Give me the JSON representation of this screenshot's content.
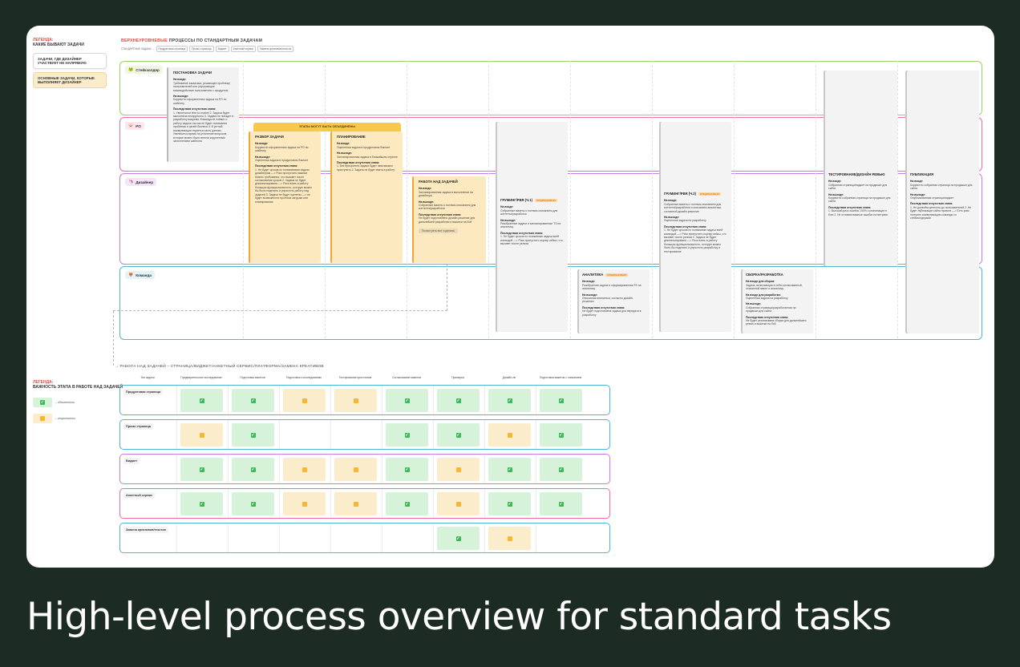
{
  "caption": "High-level process overview for standard tasks",
  "legend_top": {
    "title_red": "ЛЕГЕНДА:",
    "title": "КАКИЕ БЫВАЮТ ЗАДАЧИ",
    "item1": "ЗАДАЧИ, ГДЕ ДИЗАЙНЕР УЧАСТВУЕТ НЕ НАПРЯМУЮ",
    "item2": "ОСНОВНЫЕ ЗАДАЧИ, КОТОРЫЕ ВЫПОЛНЯЕТ ДИЗАЙНЕР"
  },
  "header": {
    "title_red": "ВЕРХНЕУРОВНЕВЫЕ",
    "title": "ПРОЦЕССЫ ПО СТАНДАРТНЫМ ЗАДАЧАМ",
    "breadcrumb_root": "СТАНДАРТНЫЕ ЗАДАЧИ →",
    "chips": [
      "Продуктовая страница",
      "Промо страница",
      "Виджет",
      "Анкетный сервис",
      "Замена креативов/текстов"
    ]
  },
  "lanes": [
    {
      "label": "Стейкхолдер",
      "icon": "🐸",
      "color": "#9ccf6a",
      "bg": "#eef7e3"
    },
    {
      "label": "PO",
      "icon": "🐷",
      "color": "#f06aa6",
      "bg": "#fde6f0"
    },
    {
      "label": "Дизайнер",
      "icon": "🦄",
      "color": "#c77be6",
      "bg": "#f3e5fa"
    },
    {
      "label": "Команда",
      "icon": "🦊",
      "color": "#4bb6d6",
      "bg": "#e2f4fa"
    }
  ],
  "cards": {
    "task_setting": {
      "title": "ПОСТАНОВКА ЗАДАЧИ",
      "in_h": "На входе:",
      "in": "Требование заказчика, решающее проблему пользователей или улучшающее взаимодействие пользователя с продуктом",
      "out_h": "На выходе:",
      "out": "Корректно оформленная задача на PO по шаблону",
      "cons_h": "Последствия отсутствия этапа:",
      "cons": "1. Увеличится time-to-market 2. Задача будет выполнена некорректно 3. Задача не попадет в разработку вовремя. Команда не поймет и работу задачи так как не будет понимания проблемы и целей бизнеса 4. В устной коммуникации теряется часть данных. Увеличится время на уточнение вопросов, которые можно было внести корректным заполнением шаблона"
    },
    "combine": "ЭТАПЫ МОГУТ БЫТЬ ОБЪЕДИНЕНЫ",
    "analysis": {
      "title": "РАЗБОР ЗАДАЧИ",
      "in_h": "На входе:",
      "in": "Корректно оформленная задача на PO по шаблону",
      "out_h": "На выходе:",
      "out": "Оцененная задача в продуктовом бэклоге",
      "cons_h": "Последствия отсутствия этапа:",
      "cons": "1. Не будет сроков по понимаемым задачи дизайнерам —> Риск пропустить важные бизнес требования, что вызовет после согласования сроков 2. Задача не будет декомпозирована —> Риск взять в работу большую функциональность, которую можно бы было поделить и упростить работу над задачей 3. Задачи не будут оценены —> не будет возможности прогноза загрузки или планирования"
    },
    "planning": {
      "title": "ПЛАНИРОВАНИЕ",
      "in_h": "На входе:",
      "in": "Оцененная задача в продуктовом бэклоге",
      "out_h": "На выходе:",
      "out": "Запланированная задача в ближайшем спринте",
      "cons_h": "Последствия отсутствия этапа:",
      "cons": "1. Без приоритета задачи будет невозможно приступить 2. Задача не будет взята в работу"
    },
    "work": {
      "title": "РАБОТА НАД ЗАДАЧЕЙ",
      "in_h": "На входе:",
      "in": "Запланированная задача в выполнении на дизайнера",
      "out_h": "На выходе:",
      "out": "Собранные макеты с полным описанием для контента/разработки",
      "cons_h": "Последствия отсутствия этапа:",
      "cons": "Не будет подготовлено дизайн-решение для дальнейшей разработки и выкатки на бой",
      "btn": "Посмотреть все подэтапы"
    },
    "grooming1": {
      "title": "ГРУМИНГ/PBR (Ч.1)",
      "tag": "опционально",
      "in_h": "На входе:",
      "in": "Собранные макеты с полным описанием для контента/разработки",
      "out_h": "На выходе:",
      "out": "Разобранные задачи и запланированные TS на аналитику",
      "cons_h": "Последствия отсутствия этапа:",
      "cons": "1. Не будет сроков по пониманию задачи всей командой —> Риск пропустить корнер кейсы, что вызовет после релиза"
    },
    "grooming2": {
      "title": "ГРУМИНГ/PBR (Ч.2)",
      "tag": "опционально",
      "in_h": "На входе:",
      "in": "Собранные макеты с полным описанием для контента/разработки и описанием аналитики, согласный дизайн-решение",
      "out_h": "На выходе:",
      "out": "Оцененная задача на разработку",
      "cons_h": "Последствия отсутствия этапа:",
      "cons": "1. Не будет сроков по пониманию задачи всей командой —> Риск пропустить корнер кейсы, что вызовет после релиза 2. Задача не будет декомпозирована —> Риск взять в работу большую функциональность, которую можно было бы поделить и упростить разработку и тестирование"
    },
    "analytics": {
      "title": "АНАЛИТИКА",
      "tag": "опционально",
      "in_h": "На входе:",
      "in": "Разобранная задача и сформированная TS на аналитику",
      "out_h": "На выходе:",
      "out": "Описанная аналитика, согласно дизайн-решению",
      "cons_h": "Последствия отсутствия этапа:",
      "cons": "Не будет подготовлена задача для передачи в разработку"
    },
    "build": {
      "title": "СБОРКА/РАЗРАБОТКА",
      "in_h": "На входе для сборки:",
      "in": "Задача, включающая в себя согласованный, описанный макет и аналитику",
      "in2_h": "На входе для разработки:",
      "in2": "Оцененная задача на разработку",
      "out_h": "На выходе:",
      "out": "Собранная страница/разработанная на продакшн для сайта",
      "cons_h": "Последствия отсутствия этапа:",
      "cons": "Не будет реализована сборка для дальнейшего ревью и выкатки на бой"
    },
    "testing": {
      "title": "ТЕСТИРОВАНИЕ/ДИЗАЙН РЕВЬЮ",
      "in_h": "На входе:",
      "in": "Собранная страница/виджет на продакшн для сайта",
      "out_h": "На выходе:",
      "out": "Корректно собранная страница на продакшн для сайта",
      "cons_h": "Последствия отсутствия этапа:",
      "cons": "1. Высокий риск ошибок 100%-х реализации в бою 2. Не отловим важные ошибки на метрики"
    },
    "publish": {
      "title": "ПУБЛИКАЦИЯ",
      "in_h": "На входе:",
      "in": "Корректно собранная страница на продакшн для сайта",
      "out_h": "На выходе:",
      "out": "Опубликованная страница/виджет",
      "cons_h": "Последствия отсутствия этапа:",
      "cons": "1. Не донесём ценность до пользователей 2. Не будет публикации сайта проекта —> Есть риск потерять коммуникацию команды со стейкхолдерами"
    }
  },
  "legend_bottom": {
    "title_red": "ЛЕГЕНДА:",
    "title": "ВАЖНОСТЬ ЭТАПА В РАБОТЕ НАД ЗАДАЧЕЙ",
    "required": "– обязательно",
    "optional": "– опционально"
  },
  "table": {
    "title": "→ РАБОТА НАД ЗАДАЧЕЙ – СТРАНИЦА/ВИДЖЕТ/АНКЕТНЫЙ СЕРВИС/ПЛАТФОРМА/ЗАМЕНА КРЕАТИВОВ",
    "columns": [
      "Тип задачи",
      "Предварительное исследование",
      "Подготовка макетов",
      "Подготовка к исследованию",
      "Тестирование прототипов",
      "Согласование макетов",
      "Примерка",
      "Дизайн-ли",
      "Подготовка макетов с описанием"
    ],
    "rows": [
      {
        "label": "Продуктовая страница",
        "color": "#4bb6d6",
        "cells": [
          "g",
          "g",
          "y",
          "y",
          "g",
          "g",
          "g",
          "g"
        ]
      },
      {
        "label": "Промо страница",
        "color": "#4bb6d6",
        "cells": [
          "y",
          "g",
          "",
          "",
          "g",
          "g",
          "y",
          "g"
        ]
      },
      {
        "label": "Виджет",
        "color": "#c77be6",
        "cells": [
          "g",
          "g",
          "y",
          "y",
          "g",
          "y",
          "g",
          "g"
        ]
      },
      {
        "label": "Анкетный сервис",
        "color": "#f06aa6",
        "cells": [
          "g",
          "g",
          "y",
          "y",
          "g",
          "y",
          "g",
          "g"
        ]
      },
      {
        "label": "Замена креативов/текстов",
        "color": "#4bb6d6",
        "cells": [
          "",
          "",
          "",
          "",
          "",
          "g",
          "y",
          ""
        ]
      }
    ]
  }
}
